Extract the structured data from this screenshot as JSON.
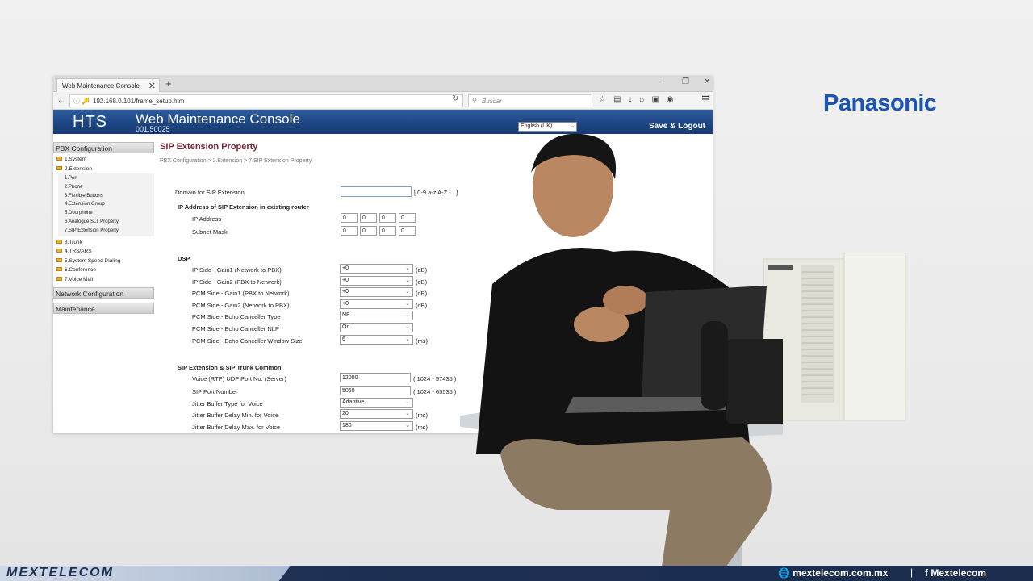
{
  "browser": {
    "tab_title": "Web Maintenance Console",
    "tab_close": "✕",
    "tab_new": "+",
    "url": "192.168.0.101/frame_setup.htm",
    "search_placeholder": "Buscar"
  },
  "header": {
    "logo": "HTS",
    "title": "Web Maintenance Console",
    "version": "001.50025",
    "language": "English (UK)",
    "logout": "Save & Logout"
  },
  "sidebar": {
    "pbx_config": "PBX Configuration",
    "items": [
      "1.System",
      "2.Extension",
      "3.Trunk",
      "4.TRS/ARS",
      "5.System Speed Dialing",
      "6.Conference",
      "7.Voice Mail"
    ],
    "extension_sub": [
      "1.Port",
      "2.Phone",
      "3.Flexible Buttons",
      "4.Extension Group",
      "5.Doorphone",
      "6.Analogue SLT Property",
      "7.SIP Extension Property"
    ],
    "network_config": "Network Configuration",
    "maintenance": "Maintenance"
  },
  "main": {
    "title": "SIP Extension Property",
    "breadcrumb": "PBX Configuration > 2.Extension > 7.SIP Extension Property",
    "domain_label": "Domain for SIP Extension",
    "domain_value": "",
    "domain_hint": "[ 0-9 a-z A-Z - . ]",
    "ip_section": "IP Address of SIP Extension in existing router",
    "ip_address_label": "IP Address",
    "ip_address": [
      "0",
      "0",
      "0",
      "0"
    ],
    "subnet_label": "Subnet Mask",
    "subnet": [
      "0",
      "0",
      "0",
      "0"
    ],
    "dsp_section": "DSP",
    "dsp": [
      {
        "label": "IP Side - Gain1 (Network to PBX)",
        "value": "+0",
        "unit": "(dB)"
      },
      {
        "label": "IP Side - Gain2 (PBX to Network)",
        "value": "+0",
        "unit": "(dB)"
      },
      {
        "label": "PCM Side - Gain1 (PBX to Network)",
        "value": "+0",
        "unit": "(dB)"
      },
      {
        "label": "PCM Side - Gain2 (Network to PBX)",
        "value": "+0",
        "unit": "(dB)"
      },
      {
        "label": "PCM Side - Echo Canceller Type",
        "value": "NE",
        "unit": ""
      },
      {
        "label": "PCM Side - Echo Canceller NLP",
        "value": "On",
        "unit": ""
      },
      {
        "label": "PCM Side - Echo Canceller Window Size",
        "value": "6",
        "unit": "(ms)"
      }
    ],
    "common_section": "SIP Extension & SIP Trunk Common",
    "rtp_label": "Voice (RTP) UDP Port No. (Server)",
    "rtp_value": "12000",
    "rtp_hint": "( 1024 - 57435 )",
    "sip_port_label": "SIP Port Number",
    "sip_port_value": "5060",
    "sip_port_hint": "( 1024 - 65535 )",
    "jitter": [
      {
        "label": "Jitter Buffer Type for Voice",
        "value": "Adaptive",
        "unit": ""
      },
      {
        "label": "Jitter Buffer Delay Min. for Voice",
        "value": "20",
        "unit": "(ms)"
      },
      {
        "label": "Jitter Buffer Delay Max. for Voice",
        "value": "180",
        "unit": "(ms)"
      }
    ]
  },
  "overlay": {
    "brand": "Panasonic",
    "bottom_logo": "MEXTELECOM",
    "website": "mextelecom.com.mx",
    "separator": "|",
    "facebook": "Mextelecom"
  }
}
